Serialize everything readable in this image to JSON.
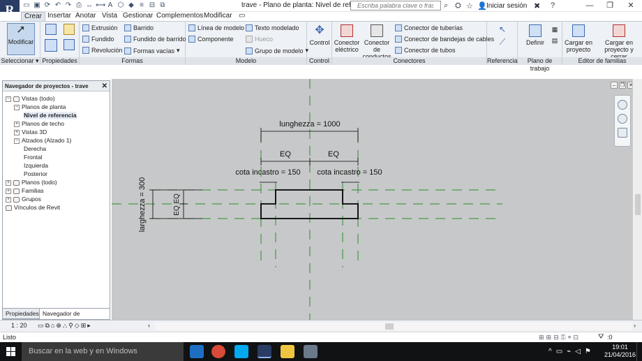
{
  "app": {
    "logo_letter": "R",
    "window_title": "trave - Plano de planta: Nivel de referencia",
    "search_placeholder": "Escriba palabra clave o frase",
    "signin": "Iniciar sesión",
    "help": "?"
  },
  "ribbon_tabs": [
    "Crear",
    "Insertar",
    "Anotar",
    "Vista",
    "Gestionar",
    "Complementos",
    "Modificar"
  ],
  "ribbon": {
    "seleccionar": {
      "button": "Modificar",
      "label": "Seleccionar"
    },
    "propiedades": {
      "label": "Propiedades"
    },
    "formas": {
      "label": "Formas",
      "items": [
        "Extrusión",
        "Fundido",
        "Revolución",
        "Barrido",
        "Fundido de barrido",
        "Formas vacías"
      ]
    },
    "modelo": {
      "label": "Modelo",
      "items": [
        "Línea de modelo",
        "Componente",
        "Texto modelado",
        "Hueco",
        "Grupo de modelo"
      ]
    },
    "control": {
      "button": "Control",
      "label": "Control"
    },
    "conectores": {
      "label": "Conectores",
      "buttons": [
        "Conector eléctrico",
        "Conector de conductos"
      ],
      "items": [
        "Conector de tuberías",
        "Conector de bandejas de cables",
        "Conector de tubos"
      ]
    },
    "referencia": {
      "label": "Referencia"
    },
    "plano_trabajo": {
      "button": "Definir",
      "label": "Plano de trabajo"
    },
    "editor_familias": {
      "label": "Editor de familias",
      "buttons": [
        "Cargar en proyecto",
        "Cargar en proyecto y cerrar"
      ]
    }
  },
  "browser": {
    "title": "Navegador de proyectos - trave",
    "tree": [
      {
        "label": "Vistas (todo)",
        "level": 0,
        "exp": "−"
      },
      {
        "label": "Planos de planta",
        "level": 1,
        "exp": "−"
      },
      {
        "label": "Nivel de referencia",
        "level": 2,
        "exp": ""
      },
      {
        "label": "Planos de techo",
        "level": 1,
        "exp": "+"
      },
      {
        "label": "Vistas 3D",
        "level": 1,
        "exp": "+"
      },
      {
        "label": "Alzados (Alzado 1)",
        "level": 1,
        "exp": "−"
      },
      {
        "label": "Derecha",
        "level": 2,
        "exp": ""
      },
      {
        "label": "Frontal",
        "level": 2,
        "exp": ""
      },
      {
        "label": "Izquierda",
        "level": 2,
        "exp": ""
      },
      {
        "label": "Posterior",
        "level": 2,
        "exp": ""
      },
      {
        "label": "Planos (todo)",
        "level": 0,
        "exp": "+"
      },
      {
        "label": "Familias",
        "level": 0,
        "exp": "+"
      },
      {
        "label": "Grupos",
        "level": 0,
        "exp": "+"
      },
      {
        "label": "Vínculos de Revit",
        "level": 0,
        "exp": ""
      }
    ],
    "tabs": [
      "Propiedades",
      "Navegador de proyectos -..."
    ]
  },
  "drawing": {
    "dim_total": "lunghezza = 1000",
    "dim_eq_left": "EQ",
    "dim_eq_right": "EQ",
    "dim_incastro_left": "cota incastro = 150",
    "dim_incastro_right": "cota incastro = 150",
    "dim_width": "larghezza = 300",
    "dim_eq_vert": "EQ EQ",
    "ref_plane_color": "#2e8b2e",
    "outline_color": "#000000"
  },
  "viewbar": {
    "scale": "1 : 20"
  },
  "status": {
    "text": "Listo",
    "filter_count": ":0"
  },
  "taskbar": {
    "search": "Buscar en la web y en Windows",
    "time": "19:01",
    "date": "21/04/2016"
  }
}
